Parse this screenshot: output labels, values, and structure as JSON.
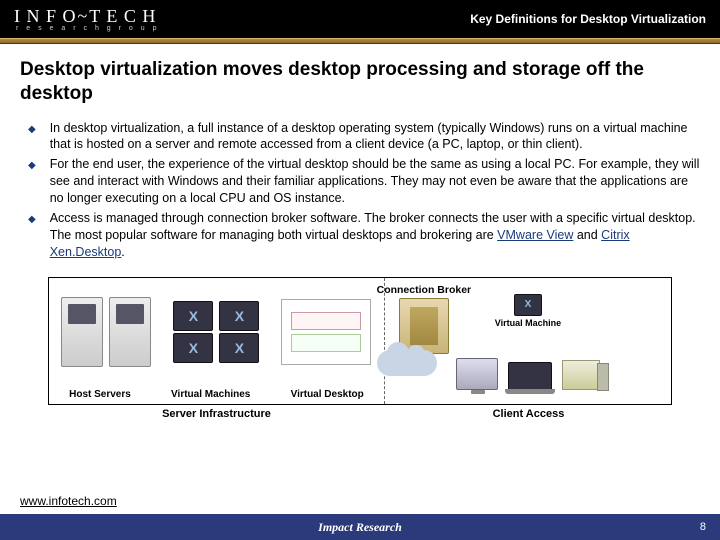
{
  "header": {
    "logo_main": "INFO~TECH",
    "logo_sub": "r e s e a r c h   g r o u p",
    "title": "Key Definitions for Desktop Virtualization"
  },
  "slide_title": "Desktop virtualization moves desktop processing and storage off the desktop",
  "bullets": [
    "In desktop virtualization, a full instance of a desktop operating system (typically Windows) runs on a virtual machine that is hosted on a server and remote accessed from a client device (a PC, laptop, or thin client).",
    "For the end user, the experience of the virtual desktop should be the same as using a local PC. For example, they will see and interact with Windows and their familiar applications. They may not even be aware that the applications are no longer executing on a local CPU and OS instance.",
    "Access is managed through connection broker software. The broker connects the user with a specific virtual desktop. The most popular software for managing both virtual desktops and brokering are "
  ],
  "links": {
    "vmware": "VMware View",
    "citrix": "Citrix Xen.Desktop"
  },
  "and": " and ",
  "period": ".",
  "diagram": {
    "broker": "Connection Broker",
    "left_labels": [
      "Host Servers",
      "Virtual Machines",
      "Virtual Desktop"
    ],
    "right_label": "Virtual Machine",
    "section_left": "Server Infrastructure",
    "section_right": "Client Access",
    "vm_glyph": "X"
  },
  "footer": {
    "url": "www.infotech.com",
    "center": "Impact Research",
    "page": "8"
  }
}
